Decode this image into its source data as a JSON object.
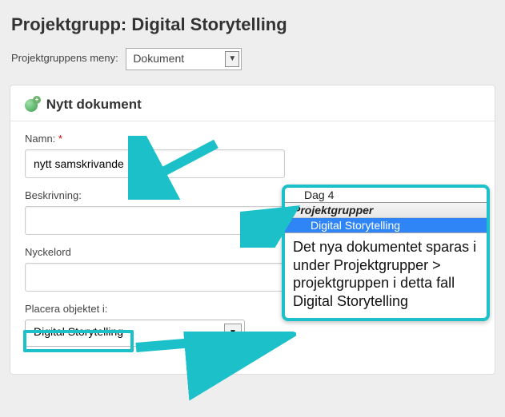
{
  "page": {
    "title": "Projektgrupp: Digital Storytelling"
  },
  "menu": {
    "label": "Projektgruppens meny:",
    "selected": "Dokument"
  },
  "panel": {
    "header": "Nytt dokument"
  },
  "form": {
    "name": {
      "label": "Namn:",
      "value": "nytt samskrivande",
      "required": "*"
    },
    "description": {
      "label": "Beskrivning:",
      "value": ""
    },
    "keywords": {
      "label": "Nyckelord",
      "value": ""
    },
    "place": {
      "label": "Placera objektet i:",
      "selected": "Digital Storytelling"
    }
  },
  "callout": {
    "list": {
      "item1": "Dag 4",
      "group": "Projektgrupper",
      "selected": "Digital Storytelling"
    },
    "text": "Det nya dokumentet sparas i under Projektgrupper > projektgruppen i detta fall Digital Storytelling"
  }
}
